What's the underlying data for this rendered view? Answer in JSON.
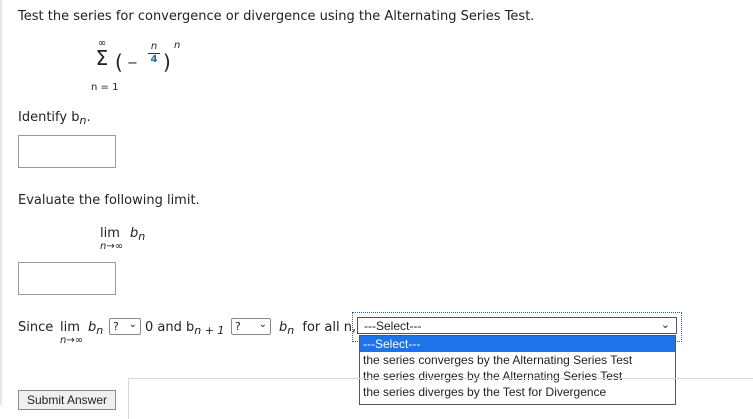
{
  "question": {
    "prompt": "Test the series for convergence or divergence using the Alternating Series Test.",
    "series": {
      "sigma": "Σ",
      "upper": "∞",
      "lower": "n = 1",
      "open": "(",
      "minus": "−",
      "numerator": "n",
      "denominator": "4",
      "close": ")",
      "exponent": "n"
    }
  },
  "identify": {
    "label": "Identify b",
    "sub": "n",
    "end": ".",
    "value": ""
  },
  "evaluate": {
    "label": "Evaluate the following limit.",
    "lim": "lim",
    "base": "b",
    "sub": "n",
    "under": "n→∞",
    "value": ""
  },
  "since": {
    "lead": "Since",
    "lim": "lim",
    "under": "n→∞",
    "base": "b",
    "sub": "n",
    "compare1": "?",
    "and_text": "0 and b",
    "sub2": "n + 1",
    "compare2": "?",
    "base3": "b",
    "sub3": "n",
    "tail": "for all n,",
    "conclusion_selected": "---Select---",
    "options": [
      "---Select---",
      "the series converges by the Alternating Series Test",
      "the series diverges by the Alternating Series Test",
      "the series diverges by the Test for Divergence"
    ]
  },
  "submit": {
    "label": "Submit Answer"
  },
  "icons": {
    "dropdown": "chevron-down-icon"
  }
}
